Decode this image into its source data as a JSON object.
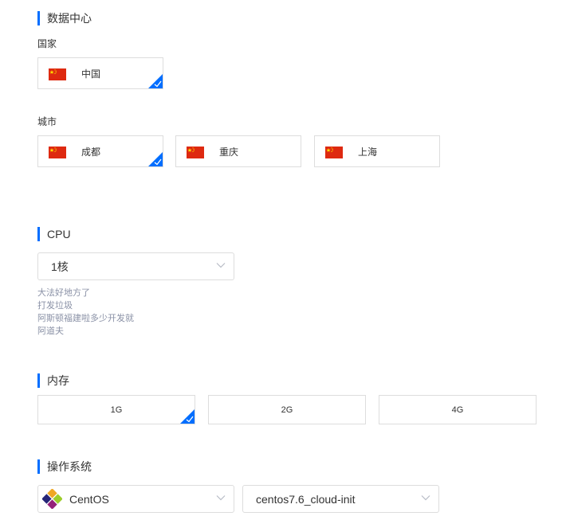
{
  "datacenter": {
    "title": "数据中心",
    "country_label": "国家",
    "countries": [
      {
        "label": "中国",
        "selected": true
      }
    ],
    "city_label": "城市",
    "cities": [
      {
        "label": "成都",
        "selected": true
      },
      {
        "label": "重庆",
        "selected": false
      },
      {
        "label": "上海",
        "selected": false
      }
    ]
  },
  "cpu": {
    "title": "CPU",
    "selected": "1核",
    "hints": [
      "大法好地方了",
      "打发垃圾",
      "阿斯顿福建啦多少开发就",
      "阿道夫"
    ]
  },
  "memory": {
    "title": "内存",
    "options": [
      {
        "label": "1G",
        "selected": true
      },
      {
        "label": "2G",
        "selected": false
      },
      {
        "label": "4G",
        "selected": false
      }
    ]
  },
  "os": {
    "title": "操作系统",
    "distro": "CentOS",
    "version": "centos7.6_cloud-init"
  },
  "colors": {
    "accent": "#006eff",
    "flag_red": "#de2910",
    "flag_yellow": "#ffde00",
    "hint": "#8a91a6"
  }
}
